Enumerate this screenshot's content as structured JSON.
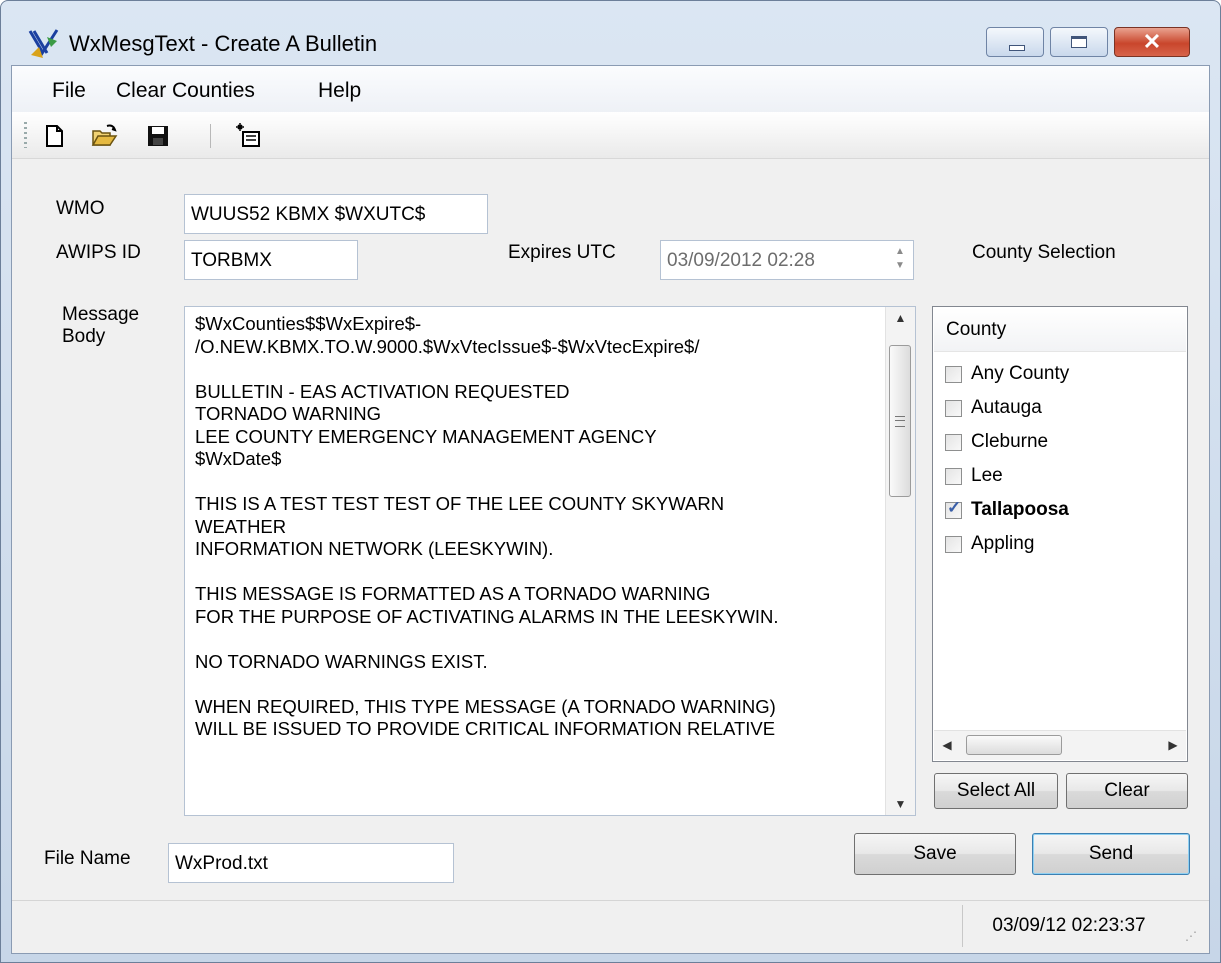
{
  "window": {
    "title": "WxMesgText - Create A Bulletin",
    "icon": "weather-app-icon",
    "close_glyph": "✕"
  },
  "menu": {
    "items": [
      "File",
      "Clear Counties",
      "Help"
    ]
  },
  "toolbar": {
    "icons": [
      "new-document-icon",
      "open-folder-icon",
      "save-disk-icon",
      "new-bulletin-icon"
    ]
  },
  "form": {
    "wmo_label": "WMO",
    "wmo_value": "WUUS52 KBMX $WXUTC$",
    "awips_label": "AWIPS ID",
    "awips_value": "TORBMX",
    "expires_label": "Expires UTC",
    "expires_value": "03/09/2012 02:28",
    "county_selection_label": "County Selection",
    "message_label_line1": "Message",
    "message_label_line2": "Body",
    "message_body": "$WxCounties$$WxExpire$-\n/O.NEW.KBMX.TO.W.9000.$WxVtecIssue$-$WxVtecExpire$/\n\nBULLETIN - EAS ACTIVATION REQUESTED\nTORNADO WARNING\nLEE COUNTY EMERGENCY MANAGEMENT AGENCY\n$WxDate$\n\nTHIS IS A TEST TEST TEST OF THE LEE COUNTY SKYWARN\nWEATHER\nINFORMATION NETWORK (LEESKYWIN).\n\nTHIS MESSAGE IS FORMATTED AS A TORNADO WARNING\nFOR THE PURPOSE OF ACTIVATING ALARMS IN THE LEESKYWIN.\n\nNO TORNADO WARNINGS EXIST.\n\nWHEN REQUIRED, THIS TYPE MESSAGE (A TORNADO WARNING)\nWILL BE ISSUED TO PROVIDE CRITICAL INFORMATION RELATIVE",
    "file_name_label": "File Name",
    "file_name_value": "WxProd.txt"
  },
  "county_list": {
    "header": "County",
    "items": [
      {
        "name": "Any County",
        "checked": false
      },
      {
        "name": "Autauga",
        "checked": false
      },
      {
        "name": "Cleburne",
        "checked": false
      },
      {
        "name": "Lee",
        "checked": false
      },
      {
        "name": "Tallapoosa",
        "checked": true
      },
      {
        "name": "Appling",
        "checked": false
      }
    ],
    "select_all_label": "Select All",
    "clear_label": "Clear"
  },
  "buttons": {
    "save_label": "Save",
    "send_label": "Send"
  },
  "status": {
    "timestamp": "03/09/12 02:23:37"
  }
}
